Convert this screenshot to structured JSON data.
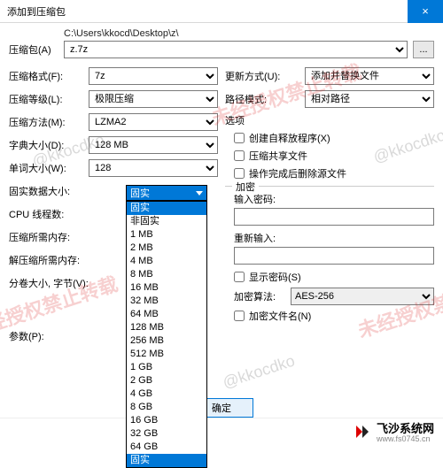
{
  "titlebar": {
    "title": "添加到压缩包",
    "close": "×"
  },
  "path_label": "C:\\Users\\kkocd\\Desktop\\z\\",
  "archive": {
    "label": "压缩包(A)",
    "file": "z.7z",
    "browse": "..."
  },
  "left": {
    "format": {
      "label": "压缩格式(F):",
      "value": "7z"
    },
    "level": {
      "label": "压缩等级(L):",
      "value": "极限压缩"
    },
    "method": {
      "label": "压缩方法(M):",
      "value": "LZMA2"
    },
    "dict": {
      "label": "字典大小(D):",
      "value": "128 MB"
    },
    "word": {
      "label": "单词大小(W):",
      "value": "128"
    },
    "solid": {
      "label": "固实数据大小:",
      "value": "固实"
    },
    "cpu": {
      "label": "CPU 线程数:",
      "value": ""
    },
    "mem_comp": {
      "label": "压缩所需内存:",
      "value": ""
    },
    "mem_decomp": {
      "label": "解压缩所需内存:",
      "value": ""
    },
    "split": {
      "label": "分卷大小, 字节(V):",
      "value": ""
    },
    "params": {
      "label": "参数(P):",
      "value": ""
    }
  },
  "right": {
    "update": {
      "label": "更新方式(U):",
      "value": "添加并替换文件"
    },
    "pathmode": {
      "label": "路径模式:",
      "value": "相对路径"
    },
    "options_title": "选项",
    "opt_sfx": "创建自释放程序(X)",
    "opt_share": "压缩共享文件",
    "opt_delete": "操作完成后删除源文件",
    "enc_title": "加密",
    "pw1": "输入密码:",
    "pw2": "重新输入:",
    "showpw": "显示密码(S)",
    "enc_method": {
      "label": "加密算法:",
      "value": "AES-256"
    },
    "enc_names": "加密文件名(N)"
  },
  "dropdown": {
    "options": [
      "固实",
      "非固实",
      "1 MB",
      "2 MB",
      "4 MB",
      "8 MB",
      "16 MB",
      "32 MB",
      "64 MB",
      "128 MB",
      "256 MB",
      "512 MB",
      "1 GB",
      "2 GB",
      "4 GB",
      "8 GB",
      "16 GB",
      "32 GB",
      "64 GB",
      "固实"
    ],
    "selected_top": "固实",
    "selected_bottom": "固实"
  },
  "buttons": {
    "ok": "确定",
    "cancel": ""
  },
  "watermark": "未经授权禁止转载",
  "wm_at": "@kkocdko",
  "brand": {
    "main": "飞沙系统网",
    "sub": "www.fs0745.cn"
  }
}
